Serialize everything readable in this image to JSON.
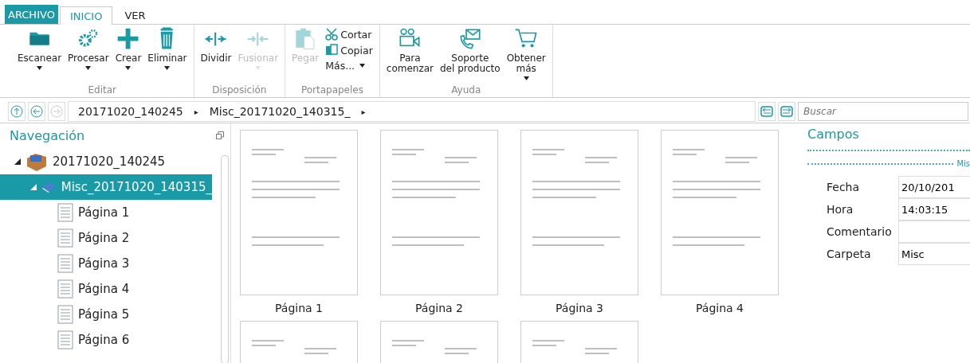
{
  "menu_tabs": [
    {
      "label": "ARCHIVO",
      "kind": "file",
      "selected": false
    },
    {
      "label": "INICIO",
      "kind": "tab",
      "selected": true
    },
    {
      "label": "VER",
      "kind": "tab",
      "selected": false
    }
  ],
  "ribbon_groups": [
    {
      "label": "Editar",
      "buttons": [
        {
          "label": "Escanear",
          "dropdown": true,
          "disabled": false
        },
        {
          "label": "Procesar",
          "dropdown": true,
          "disabled": false
        },
        {
          "label": "Crear",
          "dropdown": true,
          "disabled": false
        },
        {
          "label": "Eliminar",
          "dropdown": true,
          "disabled": false
        }
      ]
    },
    {
      "label": "Disposición",
      "buttons": [
        {
          "label": "Dividir",
          "dropdown": false,
          "disabled": false
        },
        {
          "label": "Fusionar",
          "dropdown": true,
          "disabled": true
        }
      ]
    },
    {
      "label": "Portapapeles",
      "buttons": [
        {
          "label": "Pegar",
          "dropdown": false,
          "disabled": true
        }
      ],
      "small_buttons": [
        {
          "label": "Cortar",
          "dropdown": false
        },
        {
          "label": "Copiar",
          "dropdown": false
        },
        {
          "label": "Más...",
          "dropdown": true
        }
      ]
    },
    {
      "label": "Ayuda",
      "buttons": [
        {
          "label": "Para comenzar",
          "dropdown": false,
          "disabled": false
        },
        {
          "label": "Soporte del producto",
          "dropdown": false,
          "disabled": false
        },
        {
          "label": "Obtener más",
          "dropdown": true,
          "disabled": false
        }
      ]
    }
  ],
  "breadcrumb": [
    "20171020_140245",
    "Misc_20171020_140315_"
  ],
  "breadcrumb_separator": "▸",
  "search": {
    "placeholder": "Buscar"
  },
  "navigation": {
    "title": "Navegación",
    "tree": [
      {
        "label": "20171020_140245",
        "expanded": true,
        "selected": false,
        "children": [
          {
            "label": "Misc_20171020_140315_",
            "expanded": true,
            "selected": true,
            "children": [
              {
                "label": "Página 1",
                "selected": false
              },
              {
                "label": "Página 2",
                "selected": false
              },
              {
                "label": "Página 3",
                "selected": false
              },
              {
                "label": "Página 4",
                "selected": false
              },
              {
                "label": "Página 5",
                "selected": false
              },
              {
                "label": "Página 6",
                "selected": false
              }
            ]
          }
        ]
      }
    ]
  },
  "thumbnails": [
    {
      "kind": "labeled",
      "label": "Página 1"
    },
    {
      "kind": "labeled",
      "label": "Página 2"
    },
    {
      "kind": "labeled",
      "label": "Página 3"
    },
    {
      "kind": "labeled",
      "label": "Página 4"
    },
    {
      "kind": "cut_off"
    },
    {
      "kind": "cut_off"
    },
    {
      "kind": "cut_off"
    }
  ],
  "fields": {
    "title": "Campos",
    "section": "Mis",
    "rows": [
      {
        "label": "Fecha",
        "value": "20/10/201"
      },
      {
        "label": "Hora",
        "value": "14:03:15"
      },
      {
        "label": "Comentario",
        "value": ""
      },
      {
        "label": "Carpeta",
        "value": "Misc"
      }
    ]
  }
}
